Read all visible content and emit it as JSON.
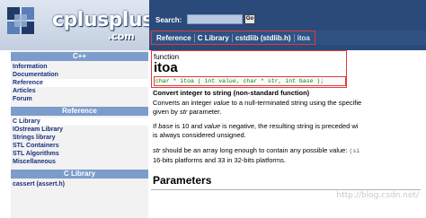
{
  "header": {
    "brand": "cplusplus",
    "brand_suffix": ".com",
    "search_label": "Search:",
    "search_value": "",
    "search_go": "Go"
  },
  "breadcrumb": [
    "Reference",
    "C Library",
    "cstdlib (stdlib.h)",
    "itoa"
  ],
  "sidebar": {
    "section1_title": "C++",
    "section1_items": [
      "Information",
      "Documentation",
      "Reference",
      "Articles",
      "Forum"
    ],
    "section2_title": "Reference",
    "section2_items": [
      "C Library",
      "IOstream Library",
      "Strings library",
      "STL Containers",
      "STL Algorithms",
      "Miscellaneous"
    ],
    "section3_title": "C Library",
    "section3_items": [
      "cassert (assert.h)"
    ]
  },
  "main": {
    "kind": "function",
    "name": "itoa",
    "prototype": "char *  itoa ( int value, char * str, int base );",
    "summary": "Convert integer to string (non-standard function)",
    "p1_a": "Converts an integer ",
    "p1_em1": "value",
    "p1_b": " to a null-terminated string using the specifie",
    "p1_c": "given by ",
    "p1_em2": "str",
    "p1_d": " parameter.",
    "p2_a": "If ",
    "p2_em1": "base",
    "p2_b": " is 10 and ",
    "p2_em2": "value",
    "p2_c": " is negative, the resulting string is preceded wi",
    "p2_d": "is always considered unsigned.",
    "p3_em": "str",
    "p3_a": " should be an array long enough to contain any possible value: ",
    "p3_mono": "(si",
    "p3_b": "16-bits platforms and 33 in 32-bits platforms.",
    "params_heading": "Parameters"
  },
  "watermark": "http://blog.csdn.net/"
}
